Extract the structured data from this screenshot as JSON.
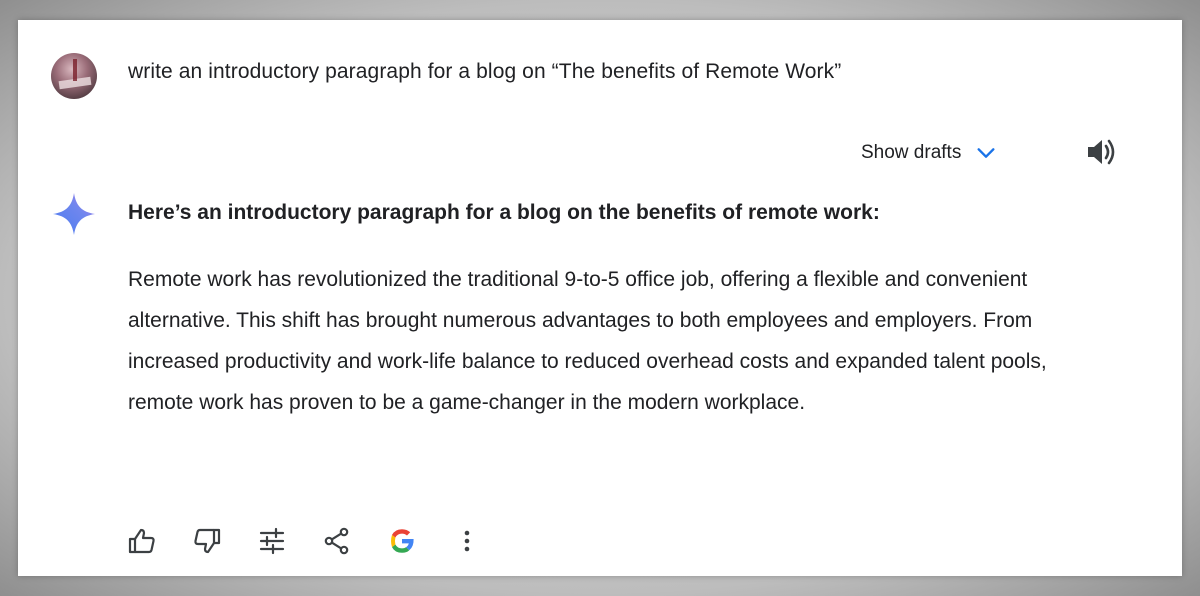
{
  "prompt": {
    "text": "write an introductory paragraph for a blog on “The benefits of Remote Work”"
  },
  "response": {
    "show_drafts_label": "Show drafts",
    "heading": "Here’s an introductory paragraph for a blog on the benefits of remote work:",
    "paragraph": "Remote work has revolutionized the traditional 9-to-5 office job, offering a flexible and convenient alternative. This shift has brought numerous advantages to both employees and employers. From increased productivity and work-life balance to reduced overhead costs and expanded talent pools, remote work has proven to be a game-changer in the modern workplace."
  },
  "icons": {
    "avatar": "user-avatar",
    "drafts_toggle": "chevron-down-icon",
    "read_aloud": "speaker-icon",
    "assistant": "sparkle-icon",
    "actions": [
      "thumbs-up-icon",
      "thumbs-down-icon",
      "tune-icon",
      "share-icon",
      "google-icon",
      "more-vert-icon"
    ]
  },
  "colors": {
    "accent_blue": "#1a73e8",
    "text": "#202124",
    "icon_gray": "#3c4043",
    "sparkle_blue": "#4a7cf0",
    "sparkle_purple": "#a77df0"
  }
}
